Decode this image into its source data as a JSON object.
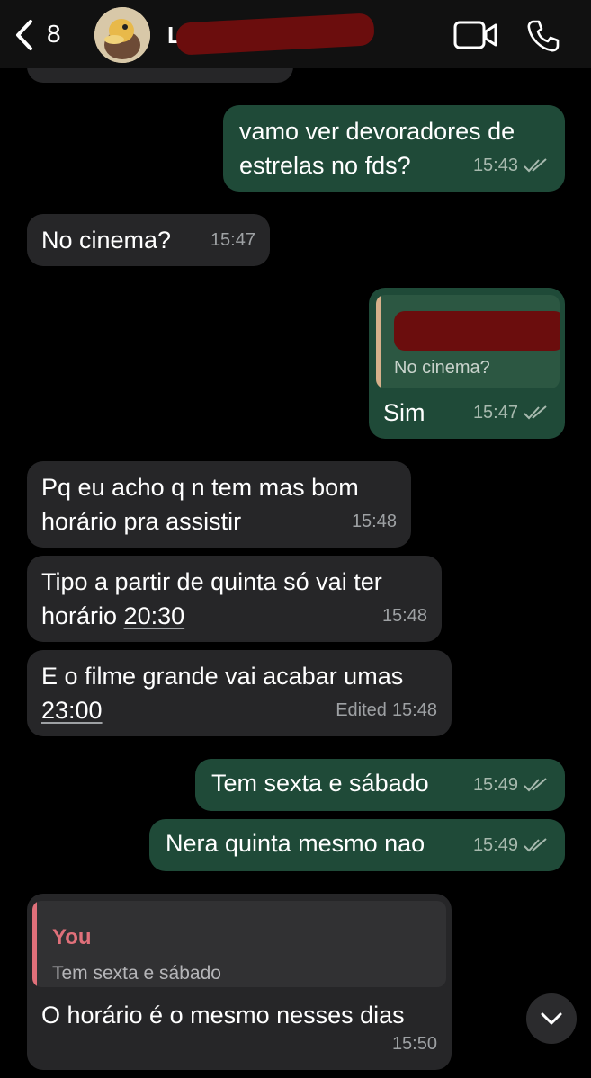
{
  "header": {
    "unread_count": "8",
    "contact_name": "L",
    "avatar_icon": "duck-avatar",
    "video_icon": "video-icon",
    "call_icon": "phone-icon"
  },
  "messages": [
    {
      "id": "m0",
      "direction": "in",
      "text": "",
      "time": ""
    },
    {
      "id": "m1",
      "direction": "out",
      "line1": "vamo ver devoradores de",
      "line2": "estrelas no fds?",
      "time": "15:43"
    },
    {
      "id": "m2",
      "direction": "in",
      "text": "No cinema?",
      "time": "15:47"
    },
    {
      "id": "m3",
      "direction": "out",
      "quote_text": "No cinema?",
      "text": "Sim",
      "time": "15:47"
    },
    {
      "id": "m4",
      "direction": "in",
      "line1": "Pq eu acho q n tem mas bom",
      "line2": "horário pra assistir",
      "time": "15:48"
    },
    {
      "id": "m5",
      "direction": "in",
      "line1": "Tipo a partir de quinta só vai ter",
      "line2_prefix": "horário ",
      "line2_link": "20:30",
      "time": "15:48"
    },
    {
      "id": "m6",
      "direction": "in",
      "line1": "E o filme grande vai acabar umas",
      "line2_link": "23:00",
      "edited": "Edited",
      "time": "15:48"
    },
    {
      "id": "m7",
      "direction": "out",
      "text": "Tem sexta e sábado",
      "time": "15:49"
    },
    {
      "id": "m8",
      "direction": "out",
      "text": "Nera quinta mesmo nao",
      "time": "15:49"
    },
    {
      "id": "m9",
      "direction": "in",
      "quote_author": "You",
      "quote_text": "Tem sexta e sábado",
      "text": "O horário é o mesmo nesses dias",
      "time": "15:50"
    }
  ],
  "colors": {
    "incoming_bubble": "#262628",
    "outgoing_bubble": "#1f4a38",
    "quote_author": "#e0707a",
    "redaction": "#6b0d0d"
  },
  "scroll_down_icon": "chevron-down-icon"
}
